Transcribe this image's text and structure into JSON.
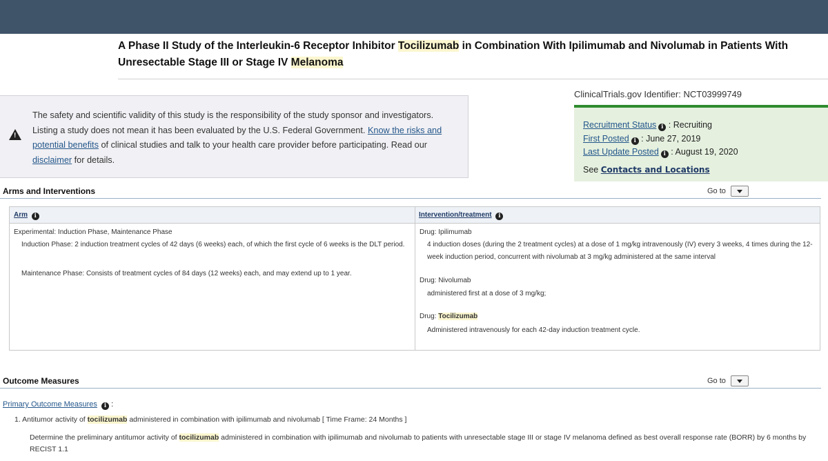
{
  "header": {
    "title_part1": "A Phase II Study of the Interleukin-6 Receptor Inhibitor ",
    "title_highlight1": "Tocilizumab",
    "title_part2": " in Combination With Ipilimumab and Nivolumab in Patients With Unresectable Stage III or Stage IV ",
    "title_highlight2": "Melanoma"
  },
  "identifier": {
    "label": "ClinicalTrials.gov Identifier:",
    "value": "NCT03999749"
  },
  "status": {
    "recruitment_label": "Recruitment Status",
    "recruitment_value": ": Recruiting",
    "first_posted_label": "First Posted",
    "first_posted_value": ": June 27, 2019",
    "last_update_label": "Last Update Posted",
    "last_update_value": ": August 19, 2020",
    "see_text": "See",
    "contacts_link": "Contacts and Locations"
  },
  "disclaimer": {
    "text1": "The safety and scientific validity of this study is the responsibility of the study sponsor and investigators. Listing a study does not mean it has been evaluated by the U.S. Federal Government. ",
    "risks_link": "Know the risks and potential benefits",
    "text2": " of clinical studies and talk to your health care provider before participating. Read our ",
    "disclaimer_link": "disclaimer",
    "text3": " for details."
  },
  "arms_section": {
    "heading": "Arms and Interventions",
    "goto_label": "Go to",
    "col_arm": "Arm",
    "col_intervention": "Intervention/treatment",
    "arm_title": "Experimental: Induction Phase, Maintenance Phase",
    "arm_induction": "Induction Phase: 2 induction treatment cycles of 42 days (6 weeks) each, of which the first cycle of 6 weeks is the DLT period.",
    "arm_maintenance": "Maintenance Phase: Consists of treatment cycles of 84 days (12 weeks) each, and may extend up to 1 year.",
    "drug1_label": "Drug: Ipilimumab",
    "drug1_desc": "4 induction doses (during the 2 treatment cycles) at a dose of 1 mg/kg intravenously (IV) every 3 weeks, 4 times during the 12-week induction period, concurrent with nivolumab at 3 mg/kg administered at the same interval",
    "drug2_label": "Drug: Nivolumab",
    "drug2_desc": "administered first at a dose of 3 mg/kg;",
    "drug3_prefix": "Drug: ",
    "drug3_name": "Tocilizumab",
    "drug3_desc": "Administered intravenously for each 42-day induction treatment cycle."
  },
  "outcome_section": {
    "heading": "Outcome Measures",
    "goto_label": "Go to",
    "primary_label": "Primary Outcome Measures",
    "primary_colon": ":",
    "item_prefix": "1. Antitumor activity of ",
    "item_highlight": "tocilizumab",
    "item_suffix": " administered in combination with ipilimumab and nivolumab [ Time Frame: 24 Months ]",
    "desc_prefix": "Determine the preliminary antitumor activity of ",
    "desc_highlight": "tocilizumab",
    "desc_suffix": " administered in combination with ipilimumab and nivolumab to patients with unresectable stage III or stage IV melanoma defined as best overall response rate (BORR) by 6 months by RECIST 1.1"
  },
  "icons": {
    "info": "info-icon",
    "warning": "warning-icon",
    "dropdown": "chevron-down-icon"
  },
  "colors": {
    "topbar": "#3f5469",
    "status_green": "#2e8b2e",
    "status_bg": "#e5f0df",
    "highlight": "#fbf6cf",
    "link": "#24578b"
  }
}
